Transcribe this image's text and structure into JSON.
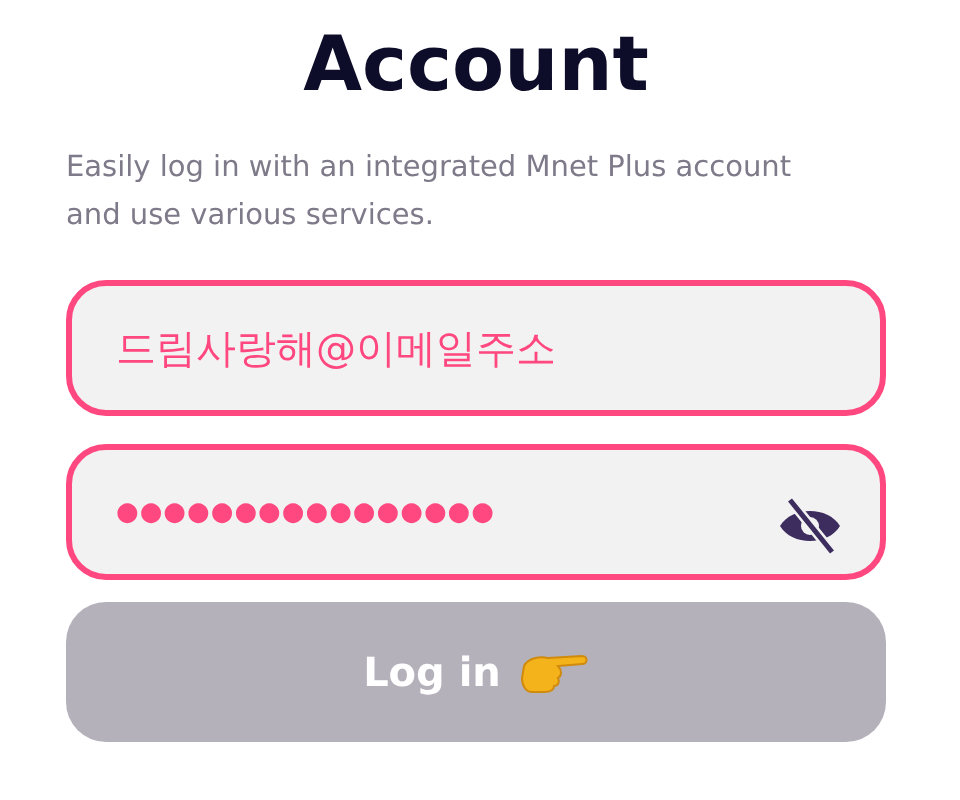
{
  "title": "Account",
  "subtitle": "Easily log in with an integrated Mnet Plus account and use various services.",
  "email_field": {
    "value": "드림사랑해@이메일주소"
  },
  "password_field": {
    "value": "●●●●●●●●●●●●●●●●",
    "password_visible": false
  },
  "login_button": {
    "label": "Log in",
    "disabled": true
  }
}
